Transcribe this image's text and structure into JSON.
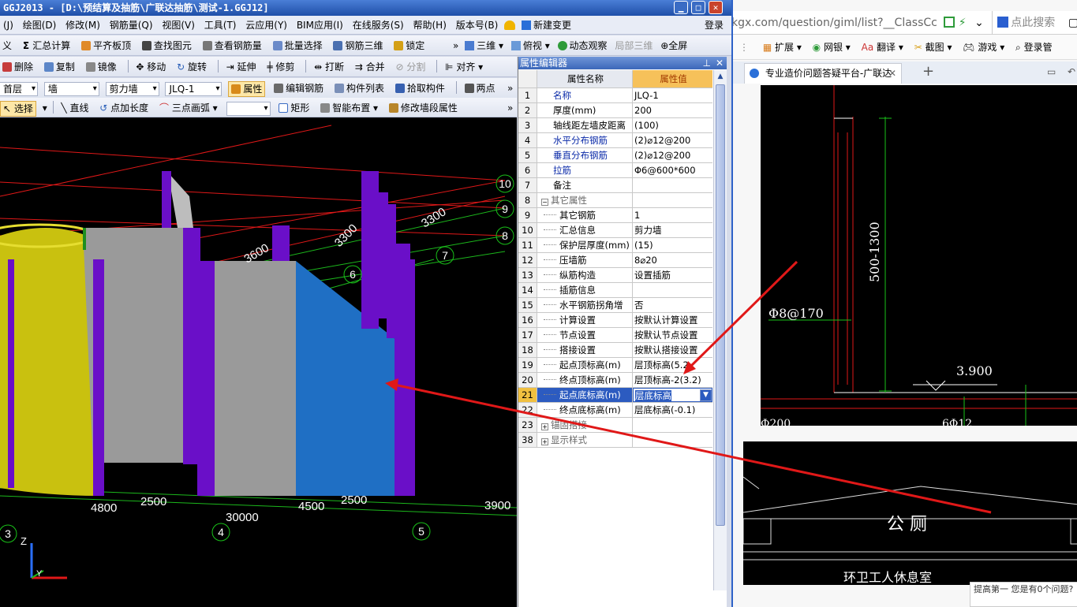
{
  "app": {
    "title": "GGJ2013 - [D:\\预结算及抽筋\\广联达抽筋\\测试-1.GGJ12]",
    "menu": [
      "(J)",
      "绘图(D)",
      "修改(M)",
      "钢筋量(Q)",
      "视图(V)",
      "工具(T)",
      "云应用(Y)",
      "BIM应用(I)",
      "在线服务(S)",
      "帮助(H)",
      "版本号(B)",
      "新建变更"
    ],
    "login": "登录",
    "toolbar1": [
      "义",
      "汇总计算",
      "平齐板顶",
      "查找图元",
      "查看钢筋量",
      "批量选择",
      "钢筋三维",
      "锁定"
    ],
    "toolbar1_right": [
      "三维",
      "俯视",
      "动态观察",
      "局部三维",
      "全屏"
    ],
    "toolbar2": [
      "删除",
      "复制",
      "镜像",
      "移动",
      "旋转",
      "延伸",
      "修剪",
      "打断",
      "合并",
      "分割",
      "对齐"
    ],
    "toolbar3": {
      "floor": "首层",
      "type": "墙",
      "subtype": "剪力墙",
      "name": "JLQ-1",
      "buttons": [
        "属性",
        "编辑钢筋",
        "构件列表",
        "拾取构件",
        "两点"
      ]
    },
    "toolbar4": [
      "选择",
      "直线",
      "点加长度",
      "三点画弧",
      "矩形",
      "智能布置",
      "修改墙段属性"
    ]
  },
  "viewport": {
    "dims": [
      "3300",
      "3300",
      "3600",
      "4800",
      "2500",
      "4500",
      "2500",
      "3900",
      "30000"
    ],
    "axes": [
      "10",
      "9",
      "8",
      "7",
      "6",
      "3",
      "4",
      "5"
    ],
    "axis_letters": [
      "Z",
      "Y"
    ]
  },
  "prop_editor": {
    "title": "属性编辑器",
    "col_name": "属性名称",
    "col_value": "属性值",
    "rows": [
      {
        "n": "1",
        "name": "名称",
        "value": "JLQ-1",
        "blue": true
      },
      {
        "n": "2",
        "name": "厚度(mm)",
        "value": "200"
      },
      {
        "n": "3",
        "name": "轴线距左墙皮距离",
        "value": "(100)"
      },
      {
        "n": "4",
        "name": "水平分布钢筋",
        "value": "(2)⌀12@200",
        "blue": true
      },
      {
        "n": "5",
        "name": "垂直分布钢筋",
        "value": "(2)⌀12@200",
        "blue": true
      },
      {
        "n": "6",
        "name": "拉筋",
        "value": "Φ6@600*600",
        "blue": true
      },
      {
        "n": "7",
        "name": "备注",
        "value": ""
      },
      {
        "n": "8",
        "name": "其它属性",
        "value": "",
        "group": true,
        "exp": "−"
      },
      {
        "n": "9",
        "name": "其它钢筋",
        "value": "1",
        "child": true
      },
      {
        "n": "10",
        "name": "汇总信息",
        "value": "剪力墙",
        "child": true
      },
      {
        "n": "11",
        "name": "保护层厚度(mm)",
        "value": "(15)",
        "child": true
      },
      {
        "n": "12",
        "name": "压墙筋",
        "value": "8⌀20",
        "child": true
      },
      {
        "n": "13",
        "name": "纵筋构造",
        "value": "设置插筋",
        "child": true
      },
      {
        "n": "14",
        "name": "插筋信息",
        "value": "",
        "child": true
      },
      {
        "n": "15",
        "name": "水平钢筋拐角增",
        "value": "否",
        "child": true
      },
      {
        "n": "16",
        "name": "计算设置",
        "value": "按默认计算设置",
        "child": true
      },
      {
        "n": "17",
        "name": "节点设置",
        "value": "按默认节点设置",
        "child": true
      },
      {
        "n": "18",
        "name": "搭接设置",
        "value": "按默认搭接设置",
        "child": true
      },
      {
        "n": "19",
        "name": "起点顶标高(m)",
        "value": "层顶标高(5.2",
        "child": true
      },
      {
        "n": "20",
        "name": "终点顶标高(m)",
        "value": "层顶标高-2(3.2)",
        "child": true
      },
      {
        "n": "21",
        "name": "起点底标高(m)",
        "value": "层底标高",
        "child": true,
        "selected": true
      },
      {
        "n": "22",
        "name": "终点底标高(m)",
        "value": "层底标高(-0.1)",
        "child": true
      },
      {
        "n": "23",
        "name": "锚固搭接",
        "value": "",
        "group": true,
        "exp": "+"
      },
      {
        "n": "38",
        "name": "显示样式",
        "value": "",
        "group": true,
        "exp": "+"
      }
    ]
  },
  "browser": {
    "url": "kgx.com/question/giml/list?__ClassCc",
    "search_placeholder": "点此搜索",
    "bookmarks": [
      "扩展",
      "网银",
      "翻译",
      "截图",
      "游戏",
      "登录管"
    ],
    "tab_title": "专业造价问题答疑平台-广联达",
    "cad1": {
      "label1": "Φ8@170",
      "label2": "500-1300",
      "label3": "3.900",
      "label4": "Φ200",
      "label5": "6Φ12"
    },
    "cad2": {
      "label1": "公 厕",
      "label2": "环卫工人休息室"
    },
    "popup": "提高第一 您是有0个问题?"
  },
  "colors": {
    "accent": "#2c5bc0",
    "wall_purple": "#6a0fc8",
    "wall_yellow": "#c9c10f",
    "wall_blue": "#1f6fc4",
    "arrow": "#e01818"
  }
}
